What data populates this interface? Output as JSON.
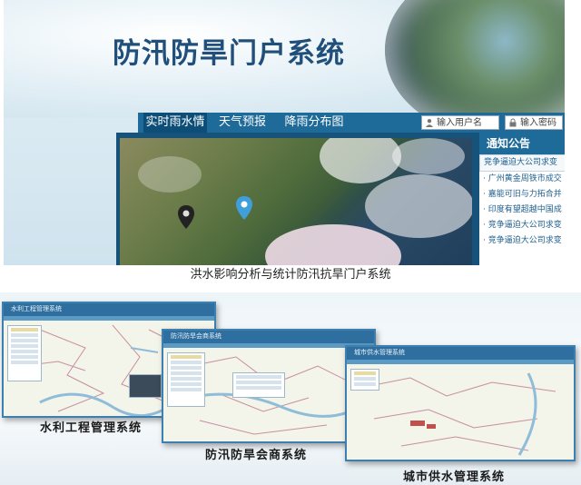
{
  "portal": {
    "title": "防汛防旱门户系统",
    "tabs": [
      {
        "label": "实时雨水情",
        "active": true
      },
      {
        "label": "天气预报",
        "active": false
      },
      {
        "label": "降雨分布图",
        "active": false
      }
    ],
    "username_placeholder": "输入用户名",
    "password_placeholder": "输入密码",
    "notice": {
      "title": "通知公告",
      "items": [
        "竞争逼迫大公司求变",
        "· 广州黄金周铁市成交",
        "· 嘉能可旧与力拓合并",
        "· 印度有望超越中国成",
        "· 竞争逼迫大公司求变",
        "· 竞争逼迫大公司求变"
      ]
    }
  },
  "caption": "洪水影响分析与统计防汛抗旱门户系统",
  "systems": [
    {
      "name": "水利工程管理系统",
      "window_title": "水利工程管理系统"
    },
    {
      "name": "防汛防旱会商系统",
      "window_title": "防汛防旱会商系统"
    },
    {
      "name": "城市供水管理系统",
      "window_title": "城市供水管理系统"
    }
  ],
  "colors": {
    "brand": "#1f4f7a",
    "nav": "#1e6a99",
    "accent": "#0d4e78"
  }
}
